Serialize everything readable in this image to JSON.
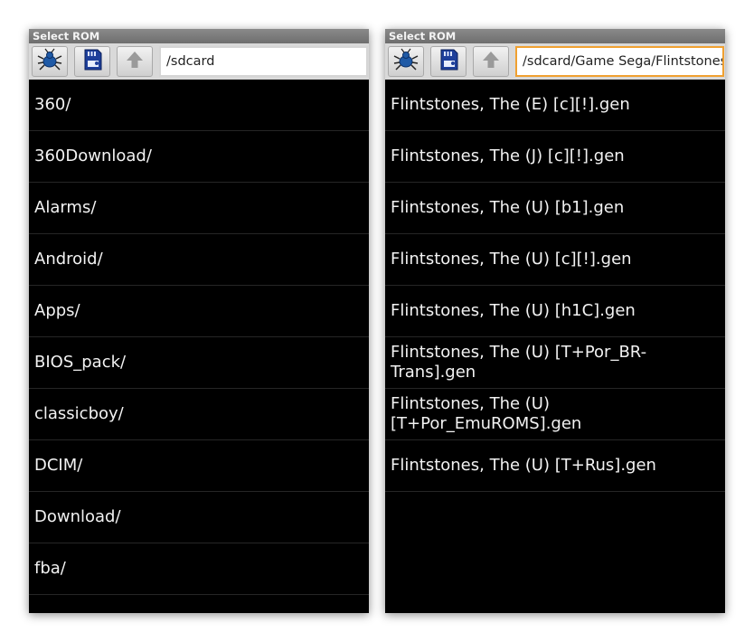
{
  "left": {
    "title": "Select ROM",
    "path": "/sdcard",
    "toolbar": {
      "icons": [
        "bug-icon",
        "sd-card-icon",
        "up-arrow-icon"
      ]
    },
    "items": [
      "360/",
      "360Download/",
      "Alarms/",
      "Android/",
      "Apps/",
      "BIOS_pack/",
      "classicboy/",
      "DCIM/",
      "Download/",
      "fba/"
    ]
  },
  "right": {
    "title": "Select ROM",
    "path": "/sdcard/Game Sega/Flintstones",
    "toolbar": {
      "icons": [
        "bug-icon",
        "sd-card-icon",
        "up-arrow-icon"
      ]
    },
    "items": [
      "Flintstones, The (E) [c][!].gen",
      "Flintstones, The (J) [c][!].gen",
      "Flintstones, The (U) [b1].gen",
      "Flintstones, The (U) [c][!].gen",
      "Flintstones, The (U) [h1C].gen",
      "Flintstones, The (U) [T+Por_BR-Trans].gen",
      "Flintstones, The (U) [T+Por_EmuROMS].gen",
      "Flintstones, The (U) [T+Rus].gen"
    ]
  },
  "colors": {
    "accent": "#f0a030",
    "background": "#000000",
    "titlebar": "#777777"
  }
}
